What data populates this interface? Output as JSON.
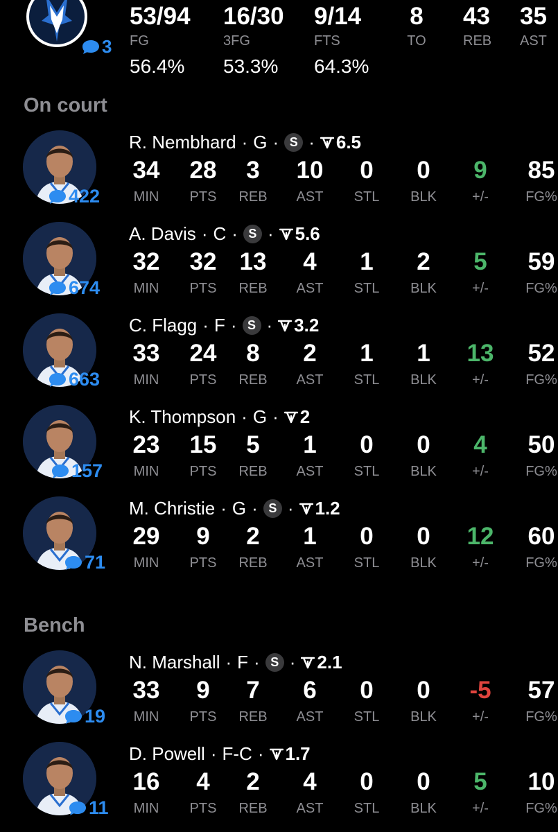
{
  "team": {
    "chat_count": "3",
    "stats": [
      {
        "value": "53/94",
        "label": "FG",
        "pct": "56.4%"
      },
      {
        "value": "16/30",
        "label": "3FG",
        "pct": "53.3%"
      },
      {
        "value": "9/14",
        "label": "FTS",
        "pct": "64.3%"
      },
      {
        "value": "8",
        "label": "TO",
        "pct": ""
      },
      {
        "value": "43",
        "label": "REB",
        "pct": ""
      },
      {
        "value": "35",
        "label": "AST",
        "pct": ""
      }
    ]
  },
  "sections": {
    "on_court": "On court",
    "bench": "Bench"
  },
  "stat_labels": {
    "min": "MIN",
    "pts": "PTS",
    "reb": "REB",
    "ast": "AST",
    "stl": "STL",
    "blk": "BLK",
    "pm": "+/-",
    "fg": "FG%"
  },
  "separator": "·",
  "starter_badge": "S",
  "players": [
    {
      "name": "R. Nembhard",
      "pos": "G",
      "starter": true,
      "rating": "6.5",
      "chat": "422",
      "min": "34",
      "pts": "28",
      "reb": "3",
      "ast": "10",
      "stl": "0",
      "blk": "0",
      "pm": "9",
      "pm_sign": "pos",
      "fg": "85"
    },
    {
      "name": "A. Davis",
      "pos": "C",
      "starter": true,
      "rating": "5.6",
      "chat": "674",
      "min": "32",
      "pts": "32",
      "reb": "13",
      "ast": "4",
      "stl": "1",
      "blk": "2",
      "pm": "5",
      "pm_sign": "pos",
      "fg": "59"
    },
    {
      "name": "C. Flagg",
      "pos": "F",
      "starter": true,
      "rating": "3.2",
      "chat": "663",
      "min": "33",
      "pts": "24",
      "reb": "8",
      "ast": "2",
      "stl": "1",
      "blk": "1",
      "pm": "13",
      "pm_sign": "pos",
      "fg": "52"
    },
    {
      "name": "K. Thompson",
      "pos": "G",
      "starter": false,
      "rating": "2",
      "chat": "157",
      "min": "23",
      "pts": "15",
      "reb": "5",
      "ast": "1",
      "stl": "0",
      "blk": "0",
      "pm": "4",
      "pm_sign": "pos",
      "fg": "50"
    },
    {
      "name": "M. Christie",
      "pos": "G",
      "starter": true,
      "rating": "1.2",
      "chat": "71",
      "min": "29",
      "pts": "9",
      "reb": "2",
      "ast": "1",
      "stl": "0",
      "blk": "0",
      "pm": "12",
      "pm_sign": "pos",
      "fg": "60"
    },
    {
      "name": "N. Marshall",
      "pos": "F",
      "starter": true,
      "rating": "2.1",
      "chat": "19",
      "min": "33",
      "pts": "9",
      "reb": "7",
      "ast": "6",
      "stl": "0",
      "blk": "0",
      "pm": "-5",
      "pm_sign": "neg",
      "fg": "57"
    },
    {
      "name": "D. Powell",
      "pos": "F-C",
      "starter": false,
      "rating": "1.7",
      "chat": "11",
      "min": "16",
      "pts": "4",
      "reb": "2",
      "ast": "4",
      "stl": "0",
      "blk": "0",
      "pm": "5",
      "pm_sign": "pos",
      "fg": "10"
    }
  ],
  "colors": {
    "accent_blue": "#2d8cf0",
    "positive": "#4cb66a",
    "negative": "#e0443e",
    "muted": "#8e8e93"
  },
  "icons": {
    "team_logo": "mavericks-logo-icon",
    "chat": "chat-bubble-icon",
    "rating": "rating-arrow-icon",
    "avatar": "player-avatar-icon"
  }
}
